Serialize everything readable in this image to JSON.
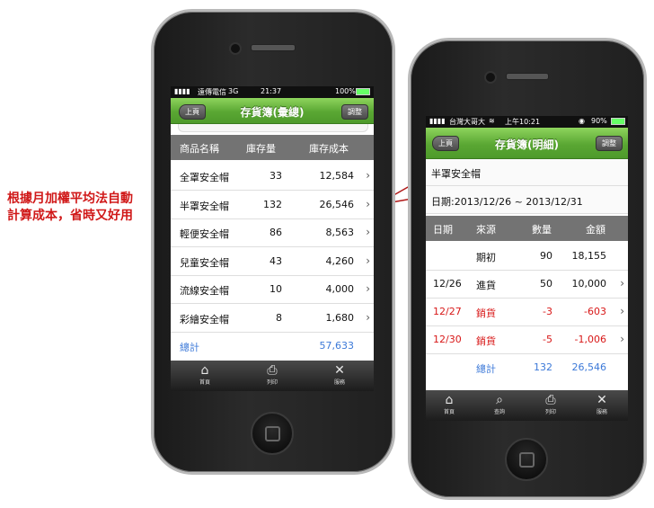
{
  "annotation": {
    "text": "根據月加權平均法自動計算成本，省時又好用"
  },
  "left_phone": {
    "status": {
      "carrier": "遠傳電信",
      "network": "3G",
      "time": "21:37",
      "battery": "100%"
    },
    "nav": {
      "title": "存貨簿(彙總)",
      "back_label": "上頁",
      "right_label": "調整"
    },
    "columns": [
      "商品名稱",
      "庫存量",
      "庫存成本"
    ],
    "rows": [
      {
        "name": "全罩安全帽",
        "qty": "33",
        "cost": "12,584"
      },
      {
        "name": "半罩安全帽",
        "qty": "132",
        "cost": "26,546"
      },
      {
        "name": "輕便安全帽",
        "qty": "86",
        "cost": "8,563"
      },
      {
        "name": "兒童安全帽",
        "qty": "43",
        "cost": "4,260"
      },
      {
        "name": "流線安全帽",
        "qty": "10",
        "cost": "4,000"
      },
      {
        "name": "彩繪安全帽",
        "qty": "8",
        "cost": "1,680"
      }
    ],
    "total": {
      "label": "總計",
      "cost": "57,633"
    },
    "tabs": [
      {
        "label": "首頁",
        "icon": "home-icon"
      },
      {
        "label": "列印",
        "icon": "printer-icon"
      },
      {
        "label": "服務",
        "icon": "tools-icon"
      }
    ]
  },
  "right_phone": {
    "status": {
      "carrier": "台灣大哥大",
      "time": "上午10:21",
      "battery": "90%"
    },
    "nav": {
      "title": "存貨簿(明細)",
      "back_label": "上頁",
      "right_label": "調整"
    },
    "item": "半罩安全帽",
    "date_range": "日期:2013/12/26 ~ 2013/12/31",
    "columns": [
      "日期",
      "來源",
      "數量",
      "金額"
    ],
    "rows": [
      {
        "date": "",
        "source": "期初",
        "qty": "90",
        "amount": "18,155",
        "color": "#111111"
      },
      {
        "date": "12/26",
        "source": "進貨",
        "qty": "50",
        "amount": "10,000",
        "color": "#111111"
      },
      {
        "date": "12/27",
        "source": "銷貨",
        "qty": "-3",
        "amount": "-603",
        "color": "#d81818"
      },
      {
        "date": "12/30",
        "source": "銷貨",
        "qty": "-5",
        "amount": "-1,006",
        "color": "#d81818"
      }
    ],
    "total": {
      "label": "總計",
      "qty": "132",
      "amount": "26,546"
    },
    "tabs": [
      {
        "label": "首頁",
        "icon": "home-icon"
      },
      {
        "label": "查詢",
        "icon": "search-icon"
      },
      {
        "label": "列印",
        "icon": "printer-icon"
      },
      {
        "label": "服務",
        "icon": "tools-icon"
      }
    ]
  },
  "colors": {
    "accent_green": "#5aa733",
    "highlight_red": "#c41818",
    "total_blue": "#3c79d8"
  }
}
